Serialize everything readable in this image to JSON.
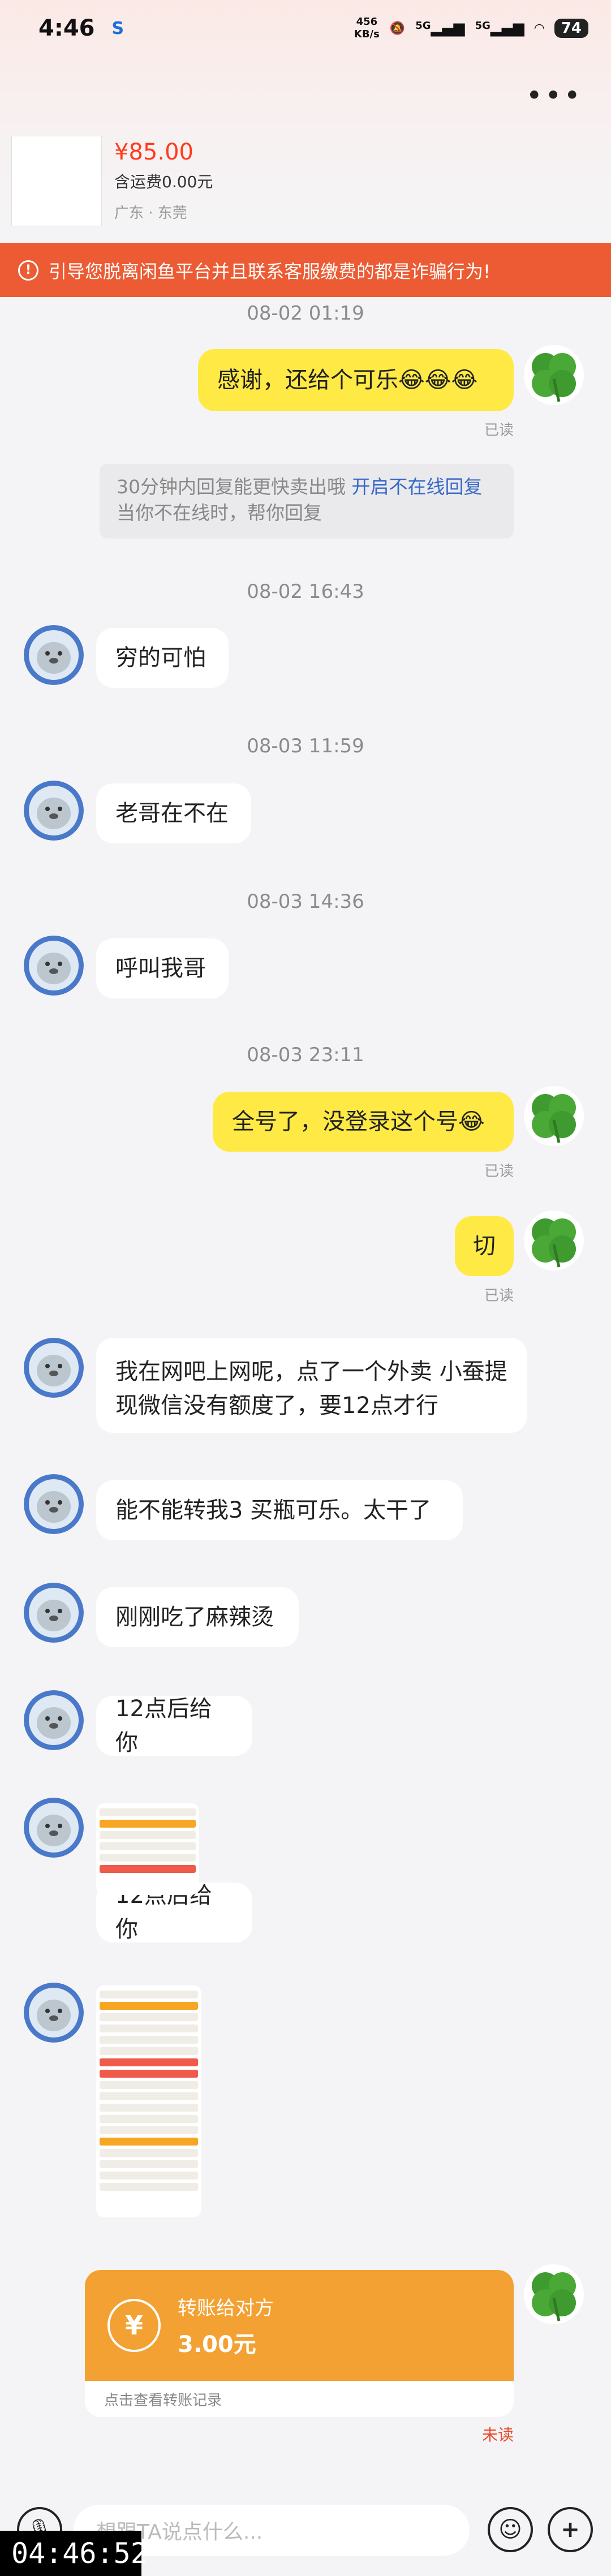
{
  "status_bar": {
    "time": "4:46",
    "net_speed_value": "456",
    "net_speed_unit": "KB/s",
    "sim1": "5G",
    "sim2": "5G",
    "battery": "74"
  },
  "product": {
    "price": "¥85.00",
    "shipping": "含运费0.00元",
    "location": "广东 · 东莞"
  },
  "warning": "引导您脱离闲鱼平台并且联系客服缴费的都是诈骗行为!",
  "system_notice": {
    "line1_text": "30分钟内回复能更快卖出哦 ",
    "line1_link": "开启不在线回复",
    "line2": "当你不在线时，帮你回复"
  },
  "messages": [
    {
      "type": "timestamp",
      "text": "08-02 01:19"
    },
    {
      "type": "out",
      "text": "感谢，还给个可乐😂😂😂",
      "status": "已读"
    },
    {
      "type": "timestamp",
      "text": "08-02 16:43"
    },
    {
      "type": "in",
      "text": "穷的可怕"
    },
    {
      "type": "timestamp",
      "text": "08-03 11:59"
    },
    {
      "type": "in",
      "text": "老哥在不在"
    },
    {
      "type": "timestamp",
      "text": "08-03 14:36"
    },
    {
      "type": "in",
      "text": "呼叫我哥"
    },
    {
      "type": "timestamp",
      "text": "08-03 23:11"
    },
    {
      "type": "out",
      "text": "全号了，没登录这个号😂",
      "status": "已读"
    },
    {
      "type": "out",
      "text": "切",
      "status": "已读"
    },
    {
      "type": "in",
      "text": "我在网吧上网呢，点了一个外卖  小蚕提现微信没有额度了，要12点才行"
    },
    {
      "type": "in",
      "text": "能不能转我3  买瓶可乐。太干了"
    },
    {
      "type": "in",
      "text": "刚刚吃了麻辣烫"
    },
    {
      "type": "in",
      "text": "12点后给你"
    },
    {
      "type": "in",
      "text": "12点后给你"
    }
  ],
  "transfer": {
    "title": "转账给对方",
    "amount": "3.00元",
    "footer": "点击查看转账记录",
    "status": "未读"
  },
  "input": {
    "placeholder": "想跟TA说点什么..."
  },
  "recording_clock": "04:46:52",
  "colors": {
    "warning_bg": "#ec5b33",
    "outgoing_bubble": "#ffe945",
    "transfer_bg": "#f3a133",
    "price": "#ff3b1f"
  }
}
